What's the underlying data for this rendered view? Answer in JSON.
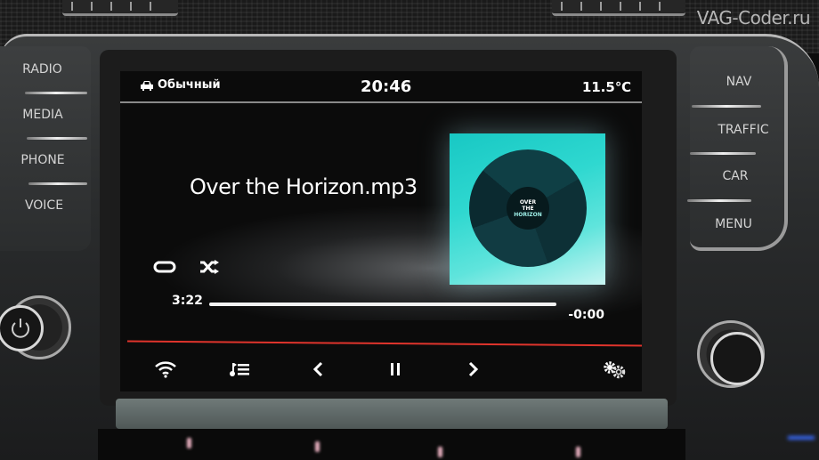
{
  "watermark": "VAG-Coder.ru",
  "hardware_buttons": {
    "left": [
      "RADIO",
      "MEDIA",
      "PHONE",
      "VOICE"
    ],
    "right": [
      "NAV",
      "TRAFFIC",
      "CAR",
      "MENU"
    ]
  },
  "status_bar": {
    "profile_icon": "car-icon",
    "profile_label": "Обычный",
    "clock": "20:46",
    "temperature": "11.5℃"
  },
  "now_playing": {
    "track_title": "Over the Horizon.mp3",
    "album_art_text": [
      "OVER",
      "THE",
      "HORIZON"
    ],
    "elapsed": "3:22",
    "remaining": "-0:00",
    "progress_fraction": 1.0
  },
  "playback_controls": {
    "repeat_icon": "repeat-icon",
    "shuffle_icon": "shuffle-icon"
  },
  "bottom_bar": [
    {
      "name": "wifi",
      "icon": "wifi-icon"
    },
    {
      "name": "playlist",
      "icon": "playlist-icon"
    },
    {
      "name": "previous",
      "icon": "previous-icon"
    },
    {
      "name": "pause",
      "icon": "pause-icon"
    },
    {
      "name": "next",
      "icon": "next-icon"
    },
    {
      "name": "settings",
      "icon": "settings-icon"
    }
  ],
  "colors": {
    "accent_red": "#e0342c",
    "album_cyan": "#2fd8d0"
  }
}
